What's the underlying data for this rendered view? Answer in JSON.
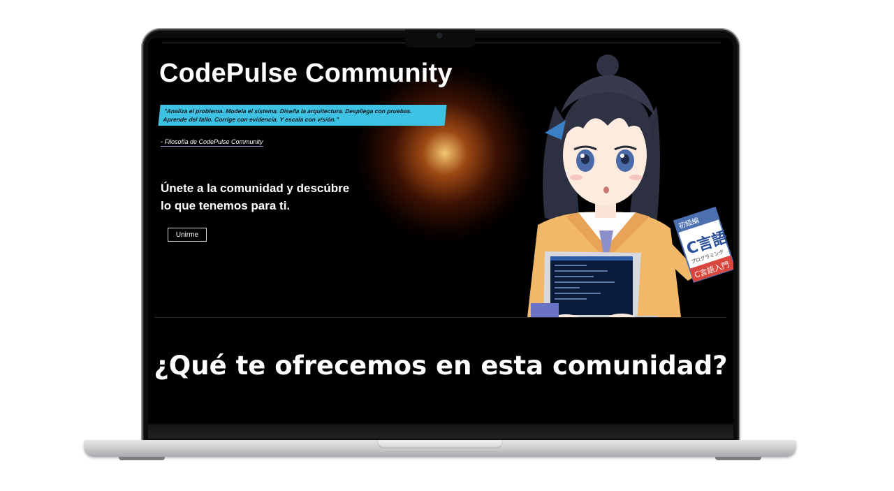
{
  "hero": {
    "title": "CodePulse Community",
    "quote_line1": "\"Analiza el problema. Modela el sistema. Diseña la arquitectura. Despliega con pruebas.",
    "quote_line2": "Aprende del fallo. Corrige con evidencia. Y escala con visión.\"",
    "attribution": "- Filosofía de CodePulse Community",
    "cta_line1": "Únete a la comunidad y descúbre",
    "cta_line2": "lo que tenemos para ti.",
    "join_label": "Unirme"
  },
  "section": {
    "heading": "¿Qué te ofrecemos en esta comunidad?"
  },
  "illustration": {
    "book_badge": "初級編",
    "book_title": "C言語",
    "book_sub": "プログラミング",
    "book_bottom": "C言語入門"
  },
  "colors": {
    "quote_bg": "#3ec2e4",
    "glow": "#f07a20",
    "attrib_underline": "#a78bd9"
  }
}
